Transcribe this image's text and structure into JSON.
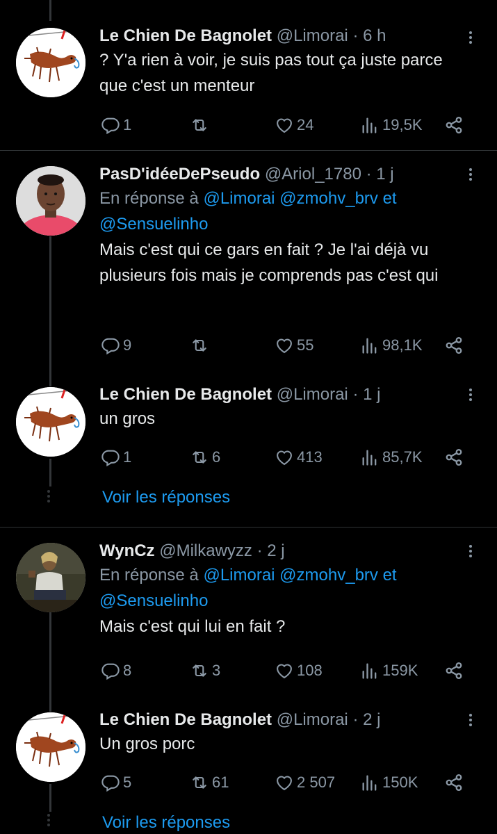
{
  "tweets": [
    {
      "name": "Le Chien De Bagnolet",
      "handle": "@Limorai",
      "time": "6 h",
      "reply_prefix": "",
      "mentions": "",
      "mentions_line2": "",
      "text": "? Y'a rien à voir, je suis pas tout ça juste parce que c'est un menteur",
      "replies": "1",
      "retweets": "",
      "likes": "24",
      "views": "19,5K"
    },
    {
      "name": "PasD'idéeDePseudo",
      "handle": "@Ariol_1780",
      "time": "1 j",
      "reply_prefix": "En réponse à",
      "mentions": "@Limorai @zmohv_brv et",
      "mentions_line2": "@Sensuelinho",
      "text": "Mais c'est qui ce gars en fait ? Je l'ai déjà vu plusieurs fois mais je comprends pas c'est qui",
      "replies": "9",
      "retweets": "",
      "likes": "55",
      "views": "98,1K"
    },
    {
      "name": "Le Chien De Bagnolet",
      "handle": "@Limorai",
      "time": "1 j",
      "text": "un gros",
      "replies": "1",
      "retweets": "6",
      "likes": "413",
      "views": "85,7K",
      "show_replies": "Voir les réponses"
    },
    {
      "name": "WynCz",
      "handle": "@Milkawyzz",
      "time": "2 j",
      "reply_prefix": "En réponse à",
      "mentions": "@Limorai @zmohv_brv et",
      "mentions_line2": "@Sensuelinho",
      "text": "Mais c'est qui lui en fait ?",
      "replies": "8",
      "retweets": "3",
      "likes": "108",
      "views": "159K"
    },
    {
      "name": "Le Chien De Bagnolet",
      "handle": "@Limorai",
      "time": "2 j",
      "text": "Un gros porc",
      "replies": "5",
      "retweets": "61",
      "likes": "2 507",
      "views": "150K",
      "show_replies": "Voir les réponses"
    }
  ],
  "separator": "·",
  "icons": {
    "reply": "speech-bubble-icon",
    "retweet": "retweet-icon",
    "like": "heart-icon",
    "views": "bar-chart-icon",
    "share": "share-icon",
    "more": "more-vertical-icon"
  },
  "colors": {
    "background": "#000000",
    "text": "#e7e9ea",
    "muted": "#8b98a5",
    "link": "#1d9bf0"
  }
}
